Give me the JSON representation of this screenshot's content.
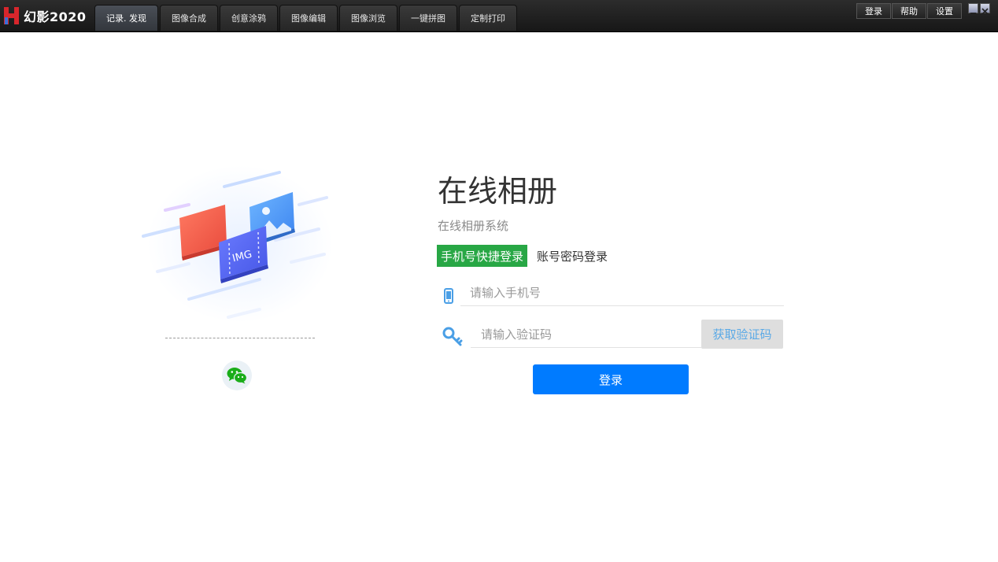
{
  "app": {
    "logo_text": "幻影2020"
  },
  "tabs": [
    {
      "label": "记录. 发现",
      "active": true
    },
    {
      "label": "图像合成",
      "active": false
    },
    {
      "label": "创意涂鸦",
      "active": false
    },
    {
      "label": "图像编辑",
      "active": false
    },
    {
      "label": "图像浏览",
      "active": false
    },
    {
      "label": "一键拼图",
      "active": false
    },
    {
      "label": "定制打印",
      "active": false
    }
  ],
  "system_buttons": {
    "login": "登录",
    "help": "帮助",
    "settings": "设置"
  },
  "illustration": {
    "card_label": "IMG"
  },
  "login": {
    "title": "在线相册",
    "subtitle": "在线相册系统",
    "tab_phone": "手机号快捷登录",
    "tab_account": "账号密码登录",
    "phone_placeholder": "请输入手机号",
    "code_placeholder": "请输入验证码",
    "get_code_button": "获取验证码",
    "submit_button": "登录"
  },
  "colors": {
    "active_tab": "#28a745",
    "primary_button": "#007bff",
    "icon_blue": "#4a9fe6",
    "wechat_green": "#1aad19"
  }
}
